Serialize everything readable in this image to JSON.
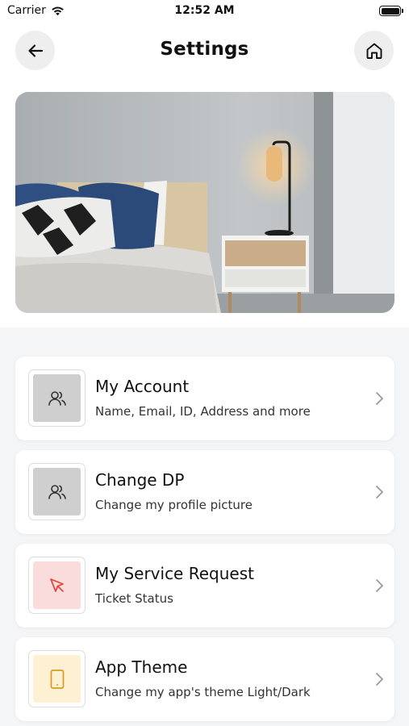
{
  "status": {
    "carrier": "Carrier",
    "time": "12:52 AM"
  },
  "header": {
    "title": "Settings",
    "back_icon": "arrow-left-icon",
    "home_icon": "home-icon"
  },
  "hero": {
    "image": "bedroom-photo"
  },
  "settings": [
    {
      "title": "My Account",
      "subtitle": "Name, Email, ID, Address and more",
      "icon": "users-icon",
      "icon_bg": "#cfcfcf",
      "icon_color": "#333333"
    },
    {
      "title": "Change DP",
      "subtitle": "Change my profile picture",
      "icon": "users-icon",
      "icon_bg": "#cfcfcf",
      "icon_color": "#333333"
    },
    {
      "title": "My Service Request",
      "subtitle": "Ticket Status",
      "icon": "cursor-icon",
      "icon_bg": "#fbdcdc",
      "icon_color": "#e0453a"
    },
    {
      "title": "App Theme",
      "subtitle": "Change my app's theme Light/Dark",
      "icon": "tablet-icon",
      "icon_bg": "#fdf0d3",
      "icon_color": "#d99b1c"
    }
  ]
}
